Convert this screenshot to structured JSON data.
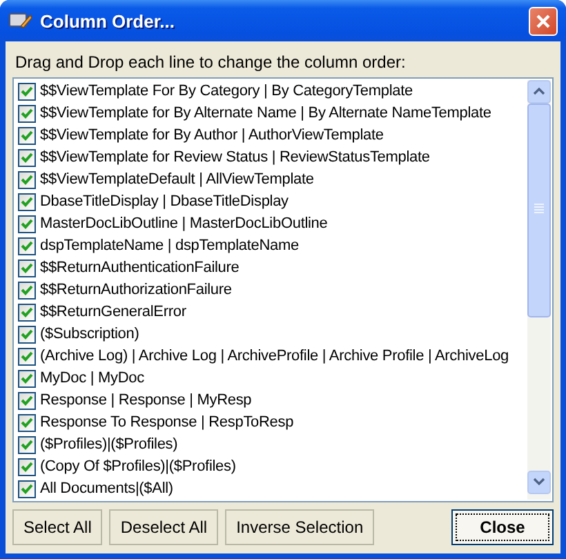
{
  "window": {
    "title": "Column Order..."
  },
  "instruction": "Drag and Drop each line to change the column order:",
  "columns": [
    {
      "label": "$$ViewTemplate For By Category | By CategoryTemplate",
      "checked": true
    },
    {
      "label": "$$ViewTemplate for By Alternate Name | By Alternate NameTemplate",
      "checked": true
    },
    {
      "label": "$$ViewTemplate for By Author | AuthorViewTemplate",
      "checked": true
    },
    {
      "label": "$$ViewTemplate for Review Status | ReviewStatusTemplate",
      "checked": true
    },
    {
      "label": "$$ViewTemplateDefault | AllViewTemplate",
      "checked": true
    },
    {
      "label": "DbaseTitleDisplay | DbaseTitleDisplay",
      "checked": true
    },
    {
      "label": "MasterDocLibOutline | MasterDocLibOutline",
      "checked": true
    },
    {
      "label": "dspTemplateName | dspTemplateName",
      "checked": true
    },
    {
      "label": "$$ReturnAuthenticationFailure",
      "checked": true
    },
    {
      "label": "$$ReturnAuthorizationFailure",
      "checked": true
    },
    {
      "label": "$$ReturnGeneralError",
      "checked": true
    },
    {
      "label": "($Subscription)",
      "checked": true
    },
    {
      "label": "(Archive Log) | Archive Log | ArchiveProfile | Archive Profile | ArchiveLog",
      "checked": true
    },
    {
      "label": "MyDoc | MyDoc",
      "checked": true
    },
    {
      "label": "Response | Response | MyResp",
      "checked": true
    },
    {
      "label": "Response To Response | RespToResp",
      "checked": true
    },
    {
      "label": "($Profiles)|($Profiles)",
      "checked": true
    },
    {
      "label": "(Copy Of $Profiles)|($Profiles)",
      "checked": true
    },
    {
      "label": "All Documents|($All)",
      "checked": true
    }
  ],
  "buttons": [
    {
      "label": "Select All",
      "kind": "normal"
    },
    {
      "label": "Deselect All",
      "kind": "normal"
    },
    {
      "label": "Inverse Selection",
      "kind": "normal"
    },
    {
      "label": "Close",
      "kind": "default"
    }
  ]
}
